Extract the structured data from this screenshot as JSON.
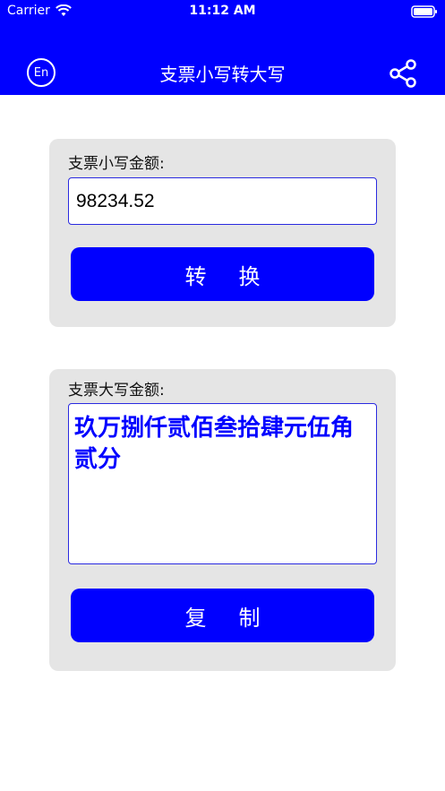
{
  "status_bar": {
    "carrier": "Carrier",
    "time": "11:12 AM"
  },
  "nav": {
    "lang_label": "En",
    "title": "支票小写转大写",
    "share_icon": "share-icon"
  },
  "lowercase": {
    "label": "支票小写金额:",
    "value": "98234.52",
    "button": "转换"
  },
  "uppercase": {
    "label": "支票大写金额:",
    "value": "玖万捌仟贰佰叁拾肆元伍角贰分",
    "button": "复制"
  },
  "colors": {
    "brand": "#0000ff",
    "panel": "#e5e5e5"
  }
}
